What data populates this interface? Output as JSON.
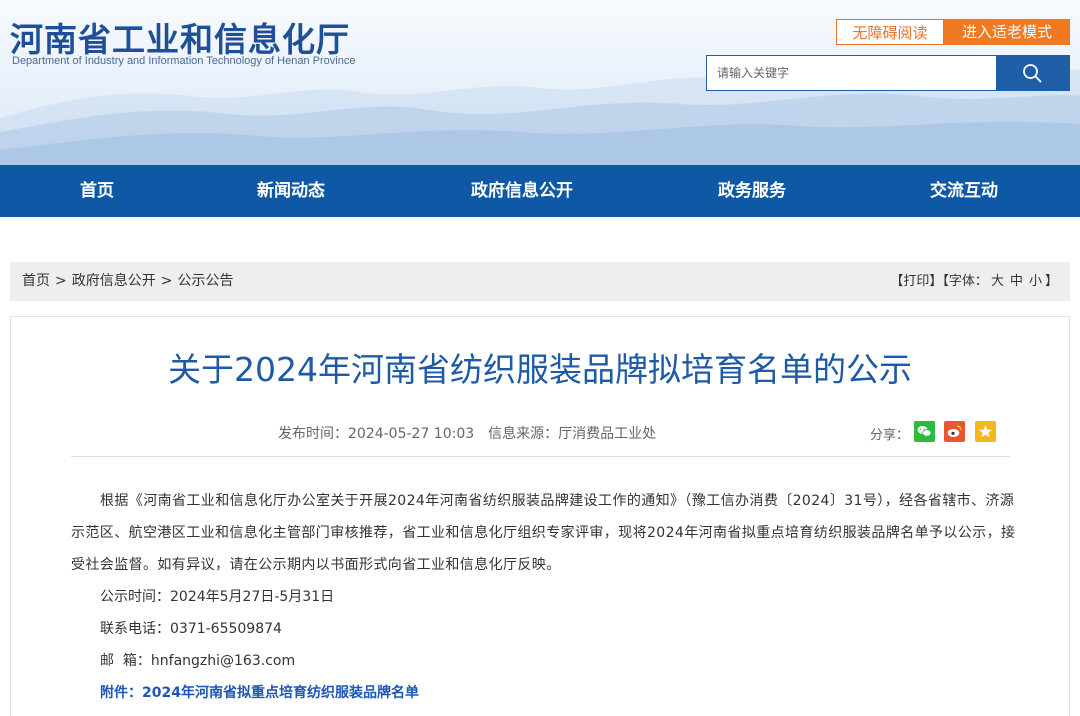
{
  "header": {
    "site_title": "河南省工业和信息化厅",
    "site_subtitle": "Department of Industry and Information Technology of Henan Province",
    "accessible_btn": "无障碍阅读",
    "elder_btn": "进入适老模式",
    "search_placeholder": "请输入关键字",
    "colors": {
      "brand": "#1f4f98",
      "nav": "#0f58a6",
      "accent": "#ef7a22"
    }
  },
  "nav": {
    "items": [
      "首页",
      "新闻动态",
      "政府信息公开",
      "政务服务",
      "交流互动"
    ]
  },
  "breadcrumb": {
    "items": [
      "首页",
      "政府信息公开",
      "公示公告"
    ],
    "separator": ">"
  },
  "tools": {
    "print": "【打印】",
    "font_label": "【字体：",
    "font_large": "大",
    "font_medium": "中",
    "font_small": "小",
    "font_end": "】"
  },
  "article": {
    "title": "关于2024年河南省纺织服装品牌拟培育名单的公示",
    "publish_time": "发布时间：2024-05-27 10:03",
    "source": "信息来源：厅消费品工业处",
    "share_label": "分享：",
    "share_icons": [
      "wechat-icon",
      "weibo-icon",
      "favorite-icon"
    ],
    "paragraph": "根据《河南省工业和信息化厅办公室关于开展2024年河南省纺织服装品牌建设工作的通知》（豫工信办消费〔2024〕31号），经各省辖市、济源示范区、航空港区工业和信息化主管部门审核推荐，省工业和信息化厅组织专家评审，现将2024年河南省拟重点培育纺织服装品牌名单予以公示，接受社会监督。如有异议，请在公示期内以书面形式向省工业和信息化厅反映。",
    "period": "公示时间：2024年5月27日-5月31日",
    "phone": "联系电话：0371-65509874",
    "email": "邮  箱：hnfangzhi@163.com",
    "attachment": "附件：2024年河南省拟重点培育纺织服装品牌名单"
  }
}
